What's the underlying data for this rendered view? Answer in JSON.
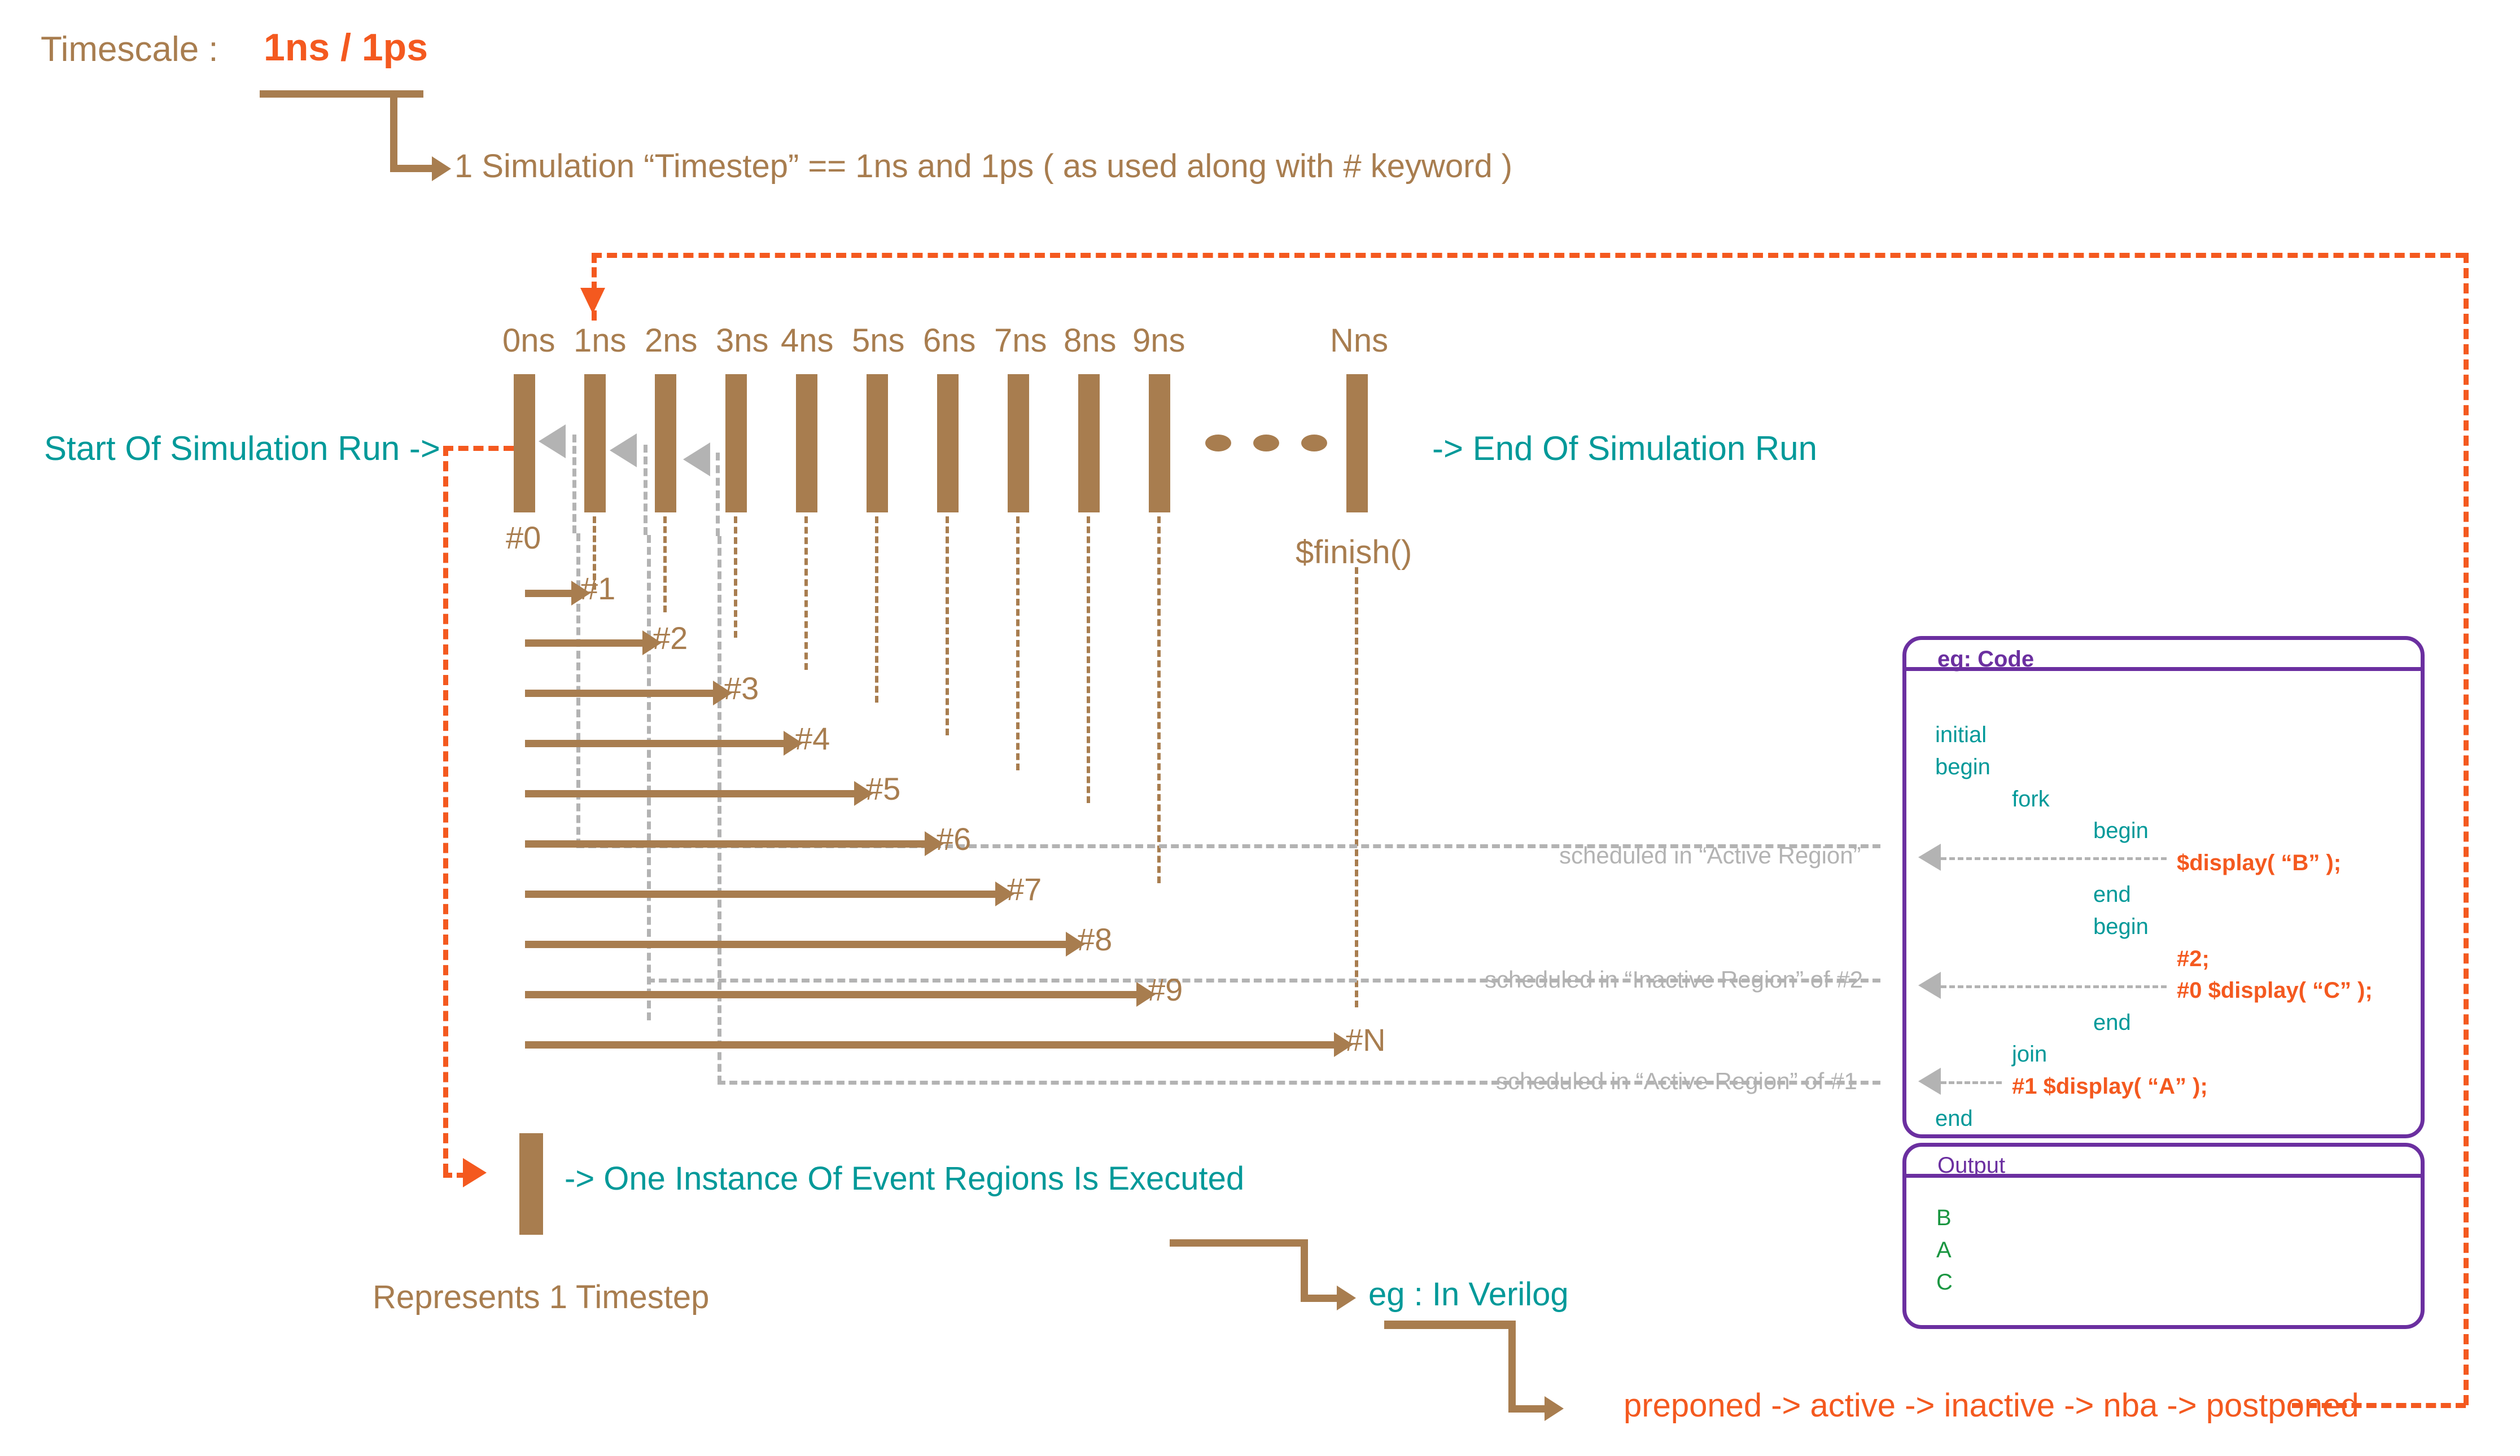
{
  "title_row": {
    "label": "Timescale :",
    "value": "1ns / 1ps"
  },
  "timescale_note": "1 Simulation “Timestep” == 1ns and 1ps ( as used along with # keyword )",
  "timeline": {
    "tick_labels": [
      "0ns",
      "1ns",
      "2ns",
      "3ns",
      "4ns",
      "5ns",
      "6ns",
      "7ns",
      "8ns",
      "9ns"
    ],
    "last_tick_label": "Nns",
    "finish_label": "$finish()",
    "start_label": "Start Of Simulation Run ->",
    "end_label": "-> End Of Simulation Run",
    "first_delay_label": "#0"
  },
  "delays": [
    {
      "label": "#1"
    },
    {
      "label": "#2"
    },
    {
      "label": "#3"
    },
    {
      "label": "#4"
    },
    {
      "label": "#5"
    },
    {
      "label": "#6"
    },
    {
      "label": "#7"
    },
    {
      "label": "#8"
    },
    {
      "label": "#9"
    },
    {
      "label": "#N"
    }
  ],
  "annotations": [
    {
      "text": "scheduled in “Active Region”"
    },
    {
      "text": "scheduled in “Inactive Region” of #2"
    },
    {
      "text": "scheduled in “Active Region” of #1"
    }
  ],
  "timestep_legend": {
    "arrow_text": "-> One Instance Of Event Regions Is Executed",
    "caption": "Represents 1 Timestep"
  },
  "verilog_note": {
    "label": "eg : In Verilog",
    "regions": "preponed -> active -> inactive -> nba -> postponed"
  },
  "code_panel": {
    "header": "eg: Code",
    "lines": [
      {
        "text": "initial",
        "indent": 0,
        "color": "teal"
      },
      {
        "text": "begin",
        "indent": 0,
        "color": "teal"
      },
      {
        "text": "fork",
        "indent": 2,
        "color": "teal"
      },
      {
        "text": "begin",
        "indent": 4,
        "color": "teal"
      },
      {
        "text": "$display( “B” );",
        "indent": 6,
        "color": "orange"
      },
      {
        "text": "end",
        "indent": 4,
        "color": "teal"
      },
      {
        "text": "begin",
        "indent": 4,
        "color": "teal"
      },
      {
        "text": "#2;",
        "indent": 6,
        "color": "orange"
      },
      {
        "text": "#0 $display( “C” );",
        "indent": 6,
        "color": "orange"
      },
      {
        "text": "end",
        "indent": 4,
        "color": "teal"
      },
      {
        "text": "join",
        "indent": 2,
        "color": "teal"
      },
      {
        "text": "#1 $display( “A” );",
        "indent": 2,
        "color": "orange"
      },
      {
        "text": "end",
        "indent": 0,
        "color": "teal"
      }
    ],
    "output_header": "Output",
    "output_lines": [
      "B",
      "A",
      "C"
    ]
  },
  "colors": {
    "brown": "#a87d4f",
    "orange": "#f4591f",
    "teal": "#009999",
    "gray": "#b3b3b3",
    "purple": "#6b2fa0",
    "green": "#1a9641"
  }
}
